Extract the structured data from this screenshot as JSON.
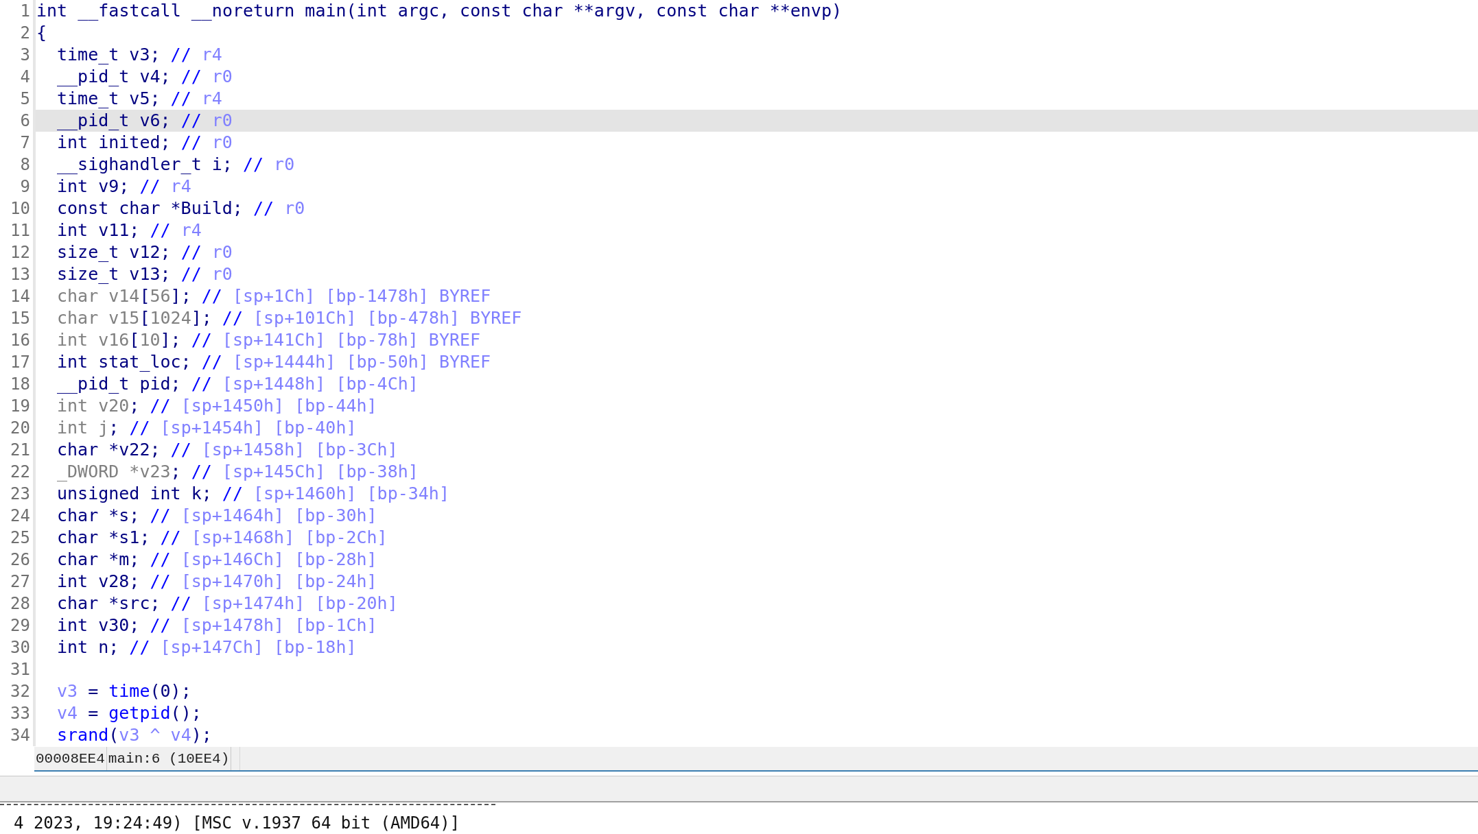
{
  "code_view": {
    "lines": [
      {
        "number": "1",
        "selected": false,
        "tokens": [
          {
            "kind": "code",
            "text": "int __fastcall __noreturn main(int argc, const char **argv, const char **envp)"
          }
        ]
      },
      {
        "number": "2",
        "selected": false,
        "tokens": [
          {
            "kind": "code",
            "text": "{"
          }
        ],
        "children": [
          {
            "number": "3",
            "selected": false,
            "tokens": [
              {
                "kind": "code",
                "text": "time_t v3; "
              },
              {
                "kind": "slash",
                "text": "// "
              },
              {
                "kind": "note",
                "text": "r4"
              }
            ]
          },
          {
            "number": "4",
            "selected": false,
            "tokens": [
              {
                "kind": "code",
                "text": "__pid_t v4; "
              },
              {
                "kind": "slash",
                "text": "// "
              },
              {
                "kind": "note",
                "text": "r0"
              }
            ]
          },
          {
            "number": "5",
            "selected": false,
            "tokens": [
              {
                "kind": "code",
                "text": "time_t v5; "
              },
              {
                "kind": "slash",
                "text": "// "
              },
              {
                "kind": "note",
                "text": "r4"
              }
            ]
          },
          {
            "number": "6",
            "selected": true,
            "tokens": [
              {
                "kind": "code",
                "text": "__pid_t v6; "
              },
              {
                "kind": "slash",
                "text": "// "
              },
              {
                "kind": "note",
                "text": "r0"
              }
            ]
          },
          {
            "number": "7",
            "selected": false,
            "tokens": [
              {
                "kind": "code",
                "text": "int inited; "
              },
              {
                "kind": "slash",
                "text": "// "
              },
              {
                "kind": "note",
                "text": "r0"
              }
            ]
          },
          {
            "number": "8",
            "selected": false,
            "tokens": [
              {
                "kind": "code",
                "text": "__sighandler_t i; "
              },
              {
                "kind": "slash",
                "text": "// "
              },
              {
                "kind": "note",
                "text": "r0"
              }
            ]
          },
          {
            "number": "9",
            "selected": false,
            "tokens": [
              {
                "kind": "code",
                "text": "int v9; "
              },
              {
                "kind": "slash",
                "text": "// "
              },
              {
                "kind": "note",
                "text": "r4"
              }
            ]
          },
          {
            "number": "10",
            "selected": false,
            "tokens": [
              {
                "kind": "code",
                "text": "const char *Build; "
              },
              {
                "kind": "slash",
                "text": "// "
              },
              {
                "kind": "note",
                "text": "r0"
              }
            ]
          },
          {
            "number": "11",
            "selected": false,
            "tokens": [
              {
                "kind": "code",
                "text": "int v11; "
              },
              {
                "kind": "slash",
                "text": "// "
              },
              {
                "kind": "note",
                "text": "r4"
              }
            ]
          },
          {
            "number": "12",
            "selected": false,
            "tokens": [
              {
                "kind": "code",
                "text": "size_t v12; "
              },
              {
                "kind": "slash",
                "text": "// "
              },
              {
                "kind": "note",
                "text": "r0"
              }
            ]
          },
          {
            "number": "13",
            "selected": false,
            "tokens": [
              {
                "kind": "code",
                "text": "size_t v13; "
              },
              {
                "kind": "slash",
                "text": "// "
              },
              {
                "kind": "note",
                "text": "r0"
              }
            ]
          },
          {
            "number": "14",
            "selected": false,
            "tokens": [
              {
                "kind": "dim",
                "text": "char v14"
              },
              {
                "kind": "code",
                "text": "["
              },
              {
                "kind": "dim",
                "text": "56"
              },
              {
                "kind": "code",
                "text": "]; "
              },
              {
                "kind": "slash",
                "text": "// "
              },
              {
                "kind": "note",
                "text": "[sp+1Ch] [bp-1478h] BYREF"
              }
            ]
          },
          {
            "number": "15",
            "selected": false,
            "tokens": [
              {
                "kind": "dim",
                "text": "char v15"
              },
              {
                "kind": "code",
                "text": "["
              },
              {
                "kind": "dim",
                "text": "1024"
              },
              {
                "kind": "code",
                "text": "]; "
              },
              {
                "kind": "slash",
                "text": "// "
              },
              {
                "kind": "note",
                "text": "[sp+101Ch] [bp-478h] BYREF"
              }
            ]
          },
          {
            "number": "16",
            "selected": false,
            "tokens": [
              {
                "kind": "dim",
                "text": "int v16"
              },
              {
                "kind": "code",
                "text": "["
              },
              {
                "kind": "dim",
                "text": "10"
              },
              {
                "kind": "code",
                "text": "]; "
              },
              {
                "kind": "slash",
                "text": "// "
              },
              {
                "kind": "note",
                "text": "[sp+141Ch] [bp-78h] BYREF"
              }
            ]
          },
          {
            "number": "17",
            "selected": false,
            "tokens": [
              {
                "kind": "code",
                "text": "int stat_loc; "
              },
              {
                "kind": "slash",
                "text": "// "
              },
              {
                "kind": "note",
                "text": "[sp+1444h] [bp-50h] BYREF"
              }
            ]
          },
          {
            "number": "18",
            "selected": false,
            "tokens": [
              {
                "kind": "code",
                "text": "__pid_t pid; "
              },
              {
                "kind": "slash",
                "text": "// "
              },
              {
                "kind": "note",
                "text": "[sp+1448h] [bp-4Ch]"
              }
            ]
          },
          {
            "number": "19",
            "selected": false,
            "tokens": [
              {
                "kind": "dim",
                "text": "int v20"
              },
              {
                "kind": "code",
                "text": "; "
              },
              {
                "kind": "slash",
                "text": "// "
              },
              {
                "kind": "note",
                "text": "[sp+1450h] [bp-44h]"
              }
            ]
          },
          {
            "number": "20",
            "selected": false,
            "tokens": [
              {
                "kind": "dim",
                "text": "int j"
              },
              {
                "kind": "code",
                "text": "; "
              },
              {
                "kind": "slash",
                "text": "// "
              },
              {
                "kind": "note",
                "text": "[sp+1454h] [bp-40h]"
              }
            ]
          },
          {
            "number": "21",
            "selected": false,
            "tokens": [
              {
                "kind": "code",
                "text": "char *v22; "
              },
              {
                "kind": "slash",
                "text": "// "
              },
              {
                "kind": "note",
                "text": "[sp+1458h] [bp-3Ch]"
              }
            ]
          },
          {
            "number": "22",
            "selected": false,
            "tokens": [
              {
                "kind": "dim",
                "text": "_DWORD *v23"
              },
              {
                "kind": "code",
                "text": "; "
              },
              {
                "kind": "slash",
                "text": "// "
              },
              {
                "kind": "note",
                "text": "[sp+145Ch] [bp-38h]"
              }
            ]
          },
          {
            "number": "23",
            "selected": false,
            "tokens": [
              {
                "kind": "code",
                "text": "unsigned int k; "
              },
              {
                "kind": "slash",
                "text": "// "
              },
              {
                "kind": "note",
                "text": "[sp+1460h] [bp-34h]"
              }
            ]
          },
          {
            "number": "24",
            "selected": false,
            "tokens": [
              {
                "kind": "code",
                "text": "char *s; "
              },
              {
                "kind": "slash",
                "text": "// "
              },
              {
                "kind": "note",
                "text": "[sp+1464h] [bp-30h]"
              }
            ]
          },
          {
            "number": "25",
            "selected": false,
            "tokens": [
              {
                "kind": "code",
                "text": "char *s1; "
              },
              {
                "kind": "slash",
                "text": "// "
              },
              {
                "kind": "note",
                "text": "[sp+1468h] [bp-2Ch]"
              }
            ]
          },
          {
            "number": "26",
            "selected": false,
            "tokens": [
              {
                "kind": "code",
                "text": "char *m; "
              },
              {
                "kind": "slash",
                "text": "// "
              },
              {
                "kind": "note",
                "text": "[sp+146Ch] [bp-28h]"
              }
            ]
          },
          {
            "number": "27",
            "selected": false,
            "tokens": [
              {
                "kind": "code",
                "text": "int v28; "
              },
              {
                "kind": "slash",
                "text": "// "
              },
              {
                "kind": "note",
                "text": "[sp+1470h] [bp-24h]"
              }
            ]
          },
          {
            "number": "28",
            "selected": false,
            "tokens": [
              {
                "kind": "code",
                "text": "char *src; "
              },
              {
                "kind": "slash",
                "text": "// "
              },
              {
                "kind": "note",
                "text": "[sp+1474h] [bp-20h]"
              }
            ]
          },
          {
            "number": "29",
            "selected": false,
            "tokens": [
              {
                "kind": "code",
                "text": "int v30; "
              },
              {
                "kind": "slash",
                "text": "// "
              },
              {
                "kind": "note",
                "text": "[sp+1478h] [bp-1Ch]"
              }
            ]
          },
          {
            "number": "30",
            "selected": false,
            "tokens": [
              {
                "kind": "code",
                "text": "int n; "
              },
              {
                "kind": "slash",
                "text": "// "
              },
              {
                "kind": "note",
                "text": "[sp+147Ch] [bp-18h]"
              }
            ]
          },
          {
            "number": "31",
            "selected": false
          },
          {
            "number": "32",
            "selected": false,
            "tokens": [
              {
                "kind": "local",
                "text": "v3"
              },
              {
                "kind": "code",
                "text": " = "
              },
              {
                "kind": "call",
                "text": "time"
              },
              {
                "kind": "code",
                "text": "(0);"
              }
            ]
          },
          {
            "number": "33",
            "selected": false,
            "tokens": [
              {
                "kind": "local",
                "text": "v4"
              },
              {
                "kind": "code",
                "text": " = "
              },
              {
                "kind": "call",
                "text": "getpid"
              },
              {
                "kind": "code",
                "text": "();"
              }
            ]
          },
          {
            "number": "34",
            "selected": false,
            "tokens": [
              {
                "kind": "call",
                "text": "srand"
              },
              {
                "kind": "code",
                "text": "("
              },
              {
                "kind": "local",
                "text": "v3 ^ v4"
              },
              {
                "kind": "code",
                "text": ");"
              }
            ]
          }
        ]
      }
    ]
  },
  "status_bar": {
    "address": "00008EE4",
    "location": "main:6 (10EE4)"
  },
  "output": {
    "lines": [
      "4 2023, 19:24:49) [MSC v.1937 64 bit (AMD64)]"
    ]
  }
}
